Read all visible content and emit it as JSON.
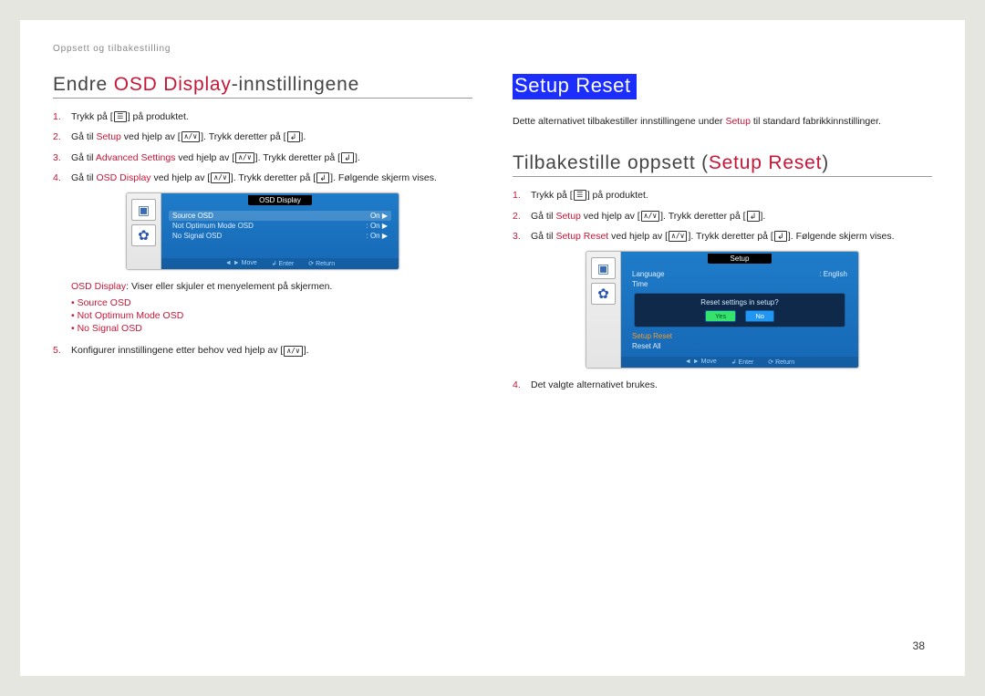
{
  "breadcrumb": "Oppsett og tilbakestilling",
  "pageNumber": "38",
  "left": {
    "heading_pre": "Endre ",
    "heading_red": "OSD Display",
    "heading_post": "-innstillingene",
    "steps": {
      "s1_a": "Trykk på [",
      "s1_b": "] på produktet.",
      "s2_a": "Gå til ",
      "s2_b": "Setup",
      "s2_c": " ved hjelp av [",
      "s2_d": "]. Trykk deretter på [",
      "s2_e": "].",
      "s3_a": "Gå til ",
      "s3_b": "Advanced Settings",
      "s3_c": " ved hjelp av [",
      "s3_d": "]. Trykk deretter på [",
      "s3_e": "].",
      "s4_a": "Gå til ",
      "s4_b": "OSD Display",
      "s4_c": " ved hjelp av [",
      "s4_d": "]. Trykk deretter på [",
      "s4_e": "]. Følgende skjerm vises.",
      "s5_a": "Konfigurer innstillingene etter behov ved hjelp av [",
      "s5_b": "]."
    },
    "note_a": "OSD Display",
    "note_b": ": Viser eller skjuler et menyelement på skjermen.",
    "bullets": [
      "Source OSD",
      "Not Optimum Mode OSD",
      "No Signal OSD"
    ],
    "osd": {
      "title": "OSD Display",
      "rows": [
        {
          "label": "Source OSD",
          "value": "On",
          "sel": true
        },
        {
          "label": "Not Optimum Mode OSD",
          "value": "On",
          "sel": false
        },
        {
          "label": "No Signal OSD",
          "value": "On",
          "sel": false
        }
      ],
      "footer": [
        "◄ ► Move",
        "↲ Enter",
        "⟳ Return"
      ]
    }
  },
  "right": {
    "highlight": "Setup Reset",
    "intro_a": "Dette alternativet tilbakestiller innstillingene under ",
    "intro_b": "Setup",
    "intro_c": " til standard fabrikkinnstillinger.",
    "heading_pre": "Tilbakestille oppsett (",
    "heading_red": "Setup Reset",
    "heading_post": ")",
    "steps": {
      "s1_a": "Trykk på [",
      "s1_b": "] på produktet.",
      "s2_a": "Gå til ",
      "s2_b": "Setup",
      "s2_c": " ved hjelp av [",
      "s2_d": "]. Trykk deretter på [",
      "s2_e": "].",
      "s3_a": "Gå til ",
      "s3_b": "Setup Reset",
      "s3_c": " ved hjelp av [",
      "s3_d": "]. Trykk deretter på [",
      "s3_e": "]. Følgende skjerm vises.",
      "s4_a": "Det valgte alternativet brukes."
    },
    "osd": {
      "title": "Setup",
      "rows": [
        {
          "label": "Language",
          "value": "English"
        },
        {
          "label": "Time",
          "value": ""
        }
      ],
      "dialog": {
        "text": "Reset settings in setup?",
        "yes": "Yes",
        "no": "No"
      },
      "orangeRows": [
        "Setup Reset"
      ],
      "plainRows": [
        "Reset All"
      ],
      "footer": [
        "◄ ► Move",
        "↲ Enter",
        "⟳ Return"
      ]
    }
  }
}
